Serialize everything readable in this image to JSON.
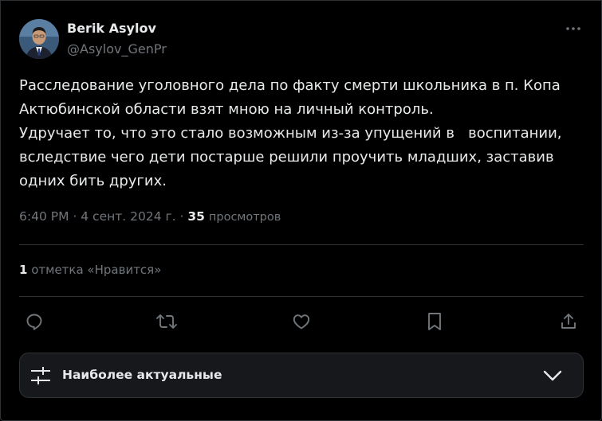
{
  "author": {
    "name": "Berik Asylov",
    "handle": "@Asylov_GenPr"
  },
  "tweet": {
    "text": "Расследование уголовного дела по факту смерти школьника в п. Копа\nАктюбинской области взят мною на личный контроль.\nУдручает то, что это стало возможным из-за упущений в   воспитании,\nвследствие чего дети постарше решили проучить младших, заставив\nодних бить других.",
    "time": "6:40 PM",
    "date": "4 сент. 2024 г.",
    "views_count": "35",
    "views_label": "просмотров"
  },
  "likes": {
    "count": "1",
    "label": "отметка «Нравится»"
  },
  "actions": [
    {
      "name": "reply",
      "icon": "reply-icon"
    },
    {
      "name": "retweet",
      "icon": "retweet-icon"
    },
    {
      "name": "like",
      "icon": "heart-icon"
    },
    {
      "name": "bookmark",
      "icon": "bookmark-icon"
    },
    {
      "name": "share",
      "icon": "share-icon"
    }
  ],
  "sort": {
    "label": "Наиболее актуальные",
    "icon": "sliders-icon",
    "chevron": "chevron-down-icon"
  },
  "colors": {
    "background": "#000000",
    "text": "#e7e9ea",
    "secondary": "#71767b",
    "border": "#2f3336"
  }
}
